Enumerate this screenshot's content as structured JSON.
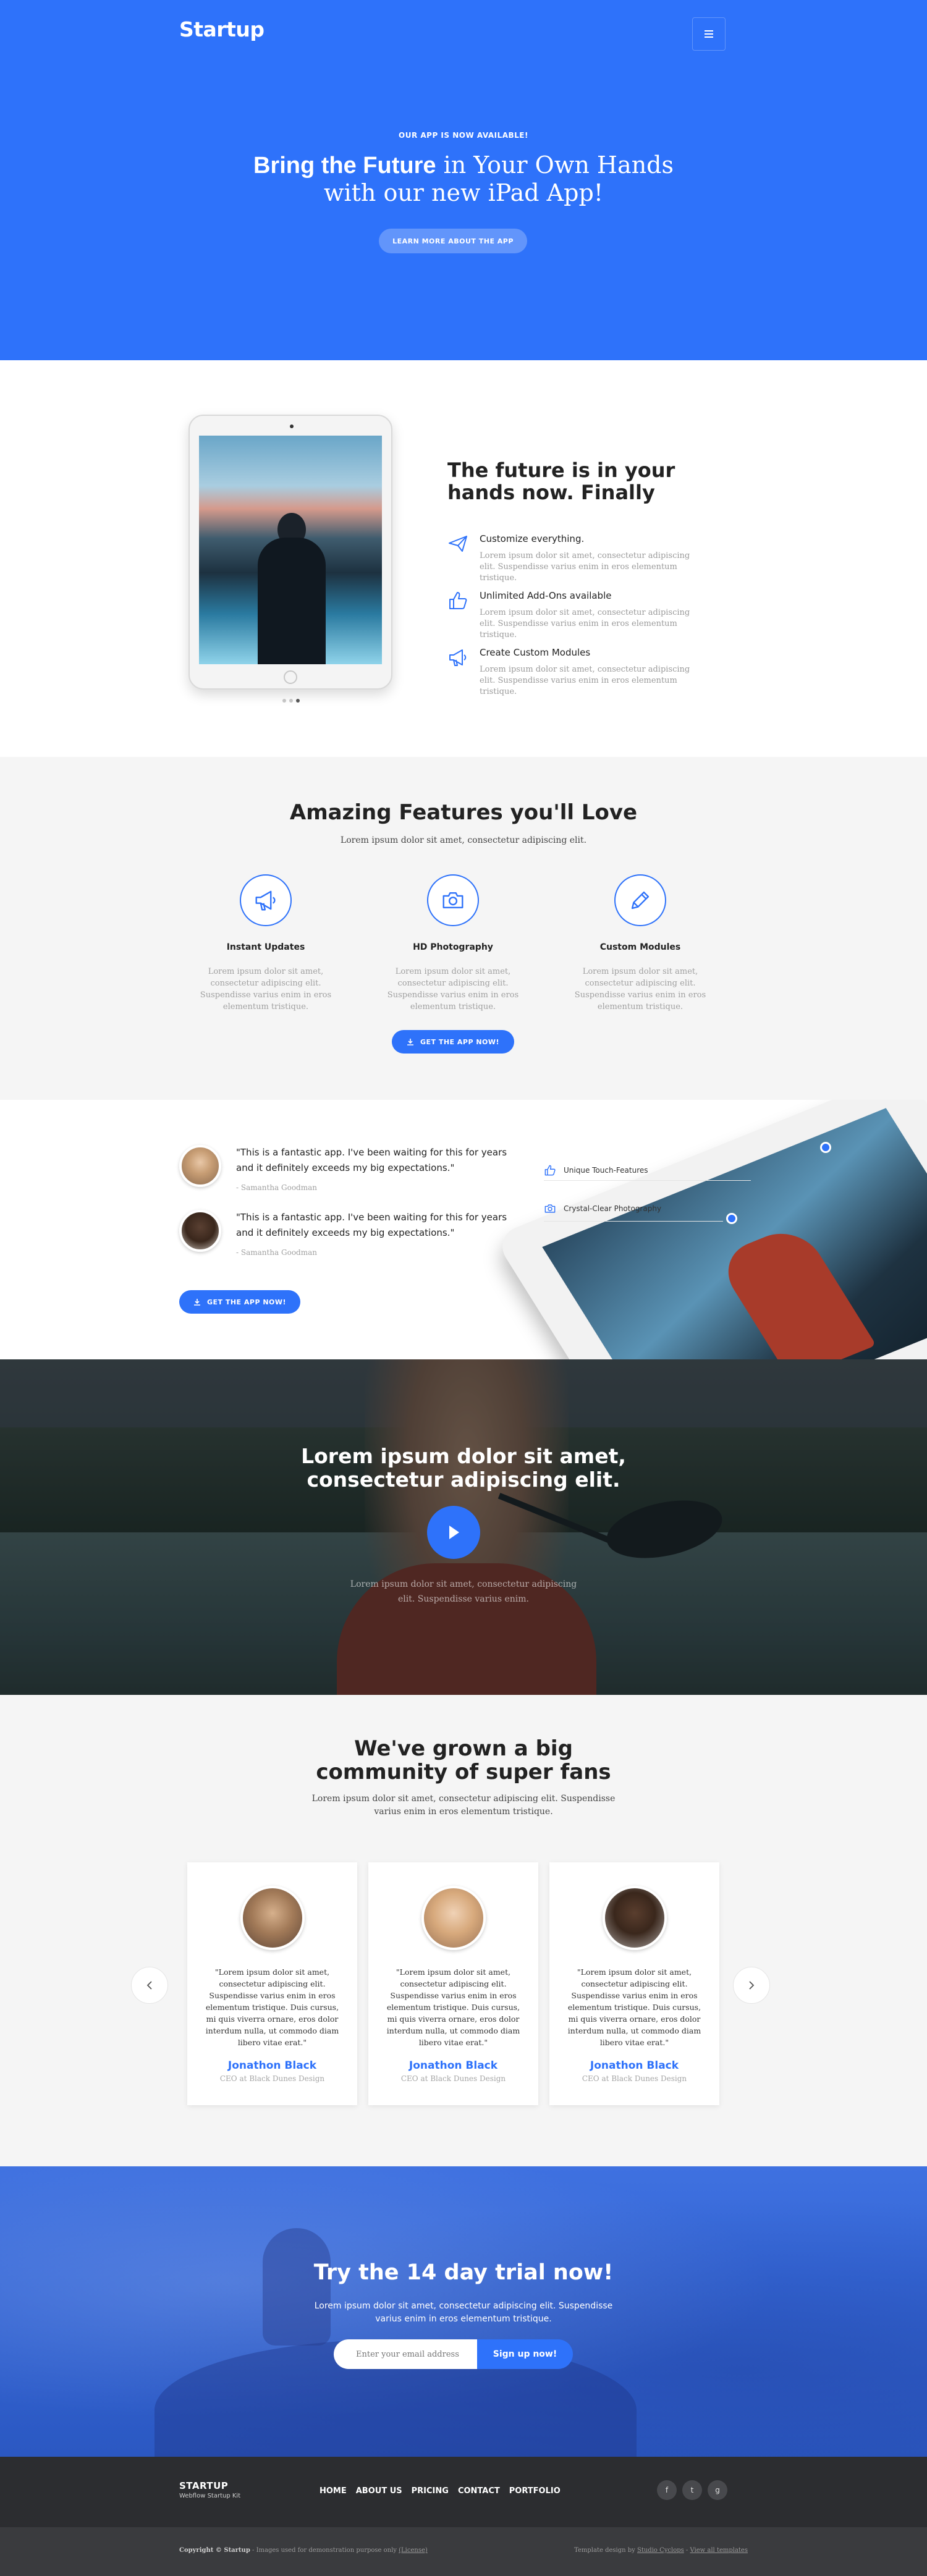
{
  "brand": {
    "logo": "Startup"
  },
  "hero": {
    "eyebrow": "OUR APP IS NOW AVAILABLE!",
    "title_bold": "Bring the Future",
    "title_light_1": " in Your Own Hands",
    "title_light_2": "with our new iPad App!",
    "button": "LEARN MORE ABOUT THE APP",
    "menu_icon": "hamburger-icon"
  },
  "intro": {
    "title": "The future is in your hands now. Finally",
    "features": [
      {
        "icon": "paper-plane-icon",
        "title": "Customize everything.",
        "desc": "Lorem ipsum dolor sit amet, consectetur adipiscing elit. Suspendisse varius enim in eros elementum tristique."
      },
      {
        "icon": "thumbs-up-icon",
        "title": "Unlimited Add-Ons available",
        "desc": "Lorem ipsum dolor sit amet, consectetur adipiscing elit. Suspendisse varius enim in eros elementum tristique."
      },
      {
        "icon": "megaphone-icon",
        "title": "Create Custom Modules",
        "desc": "Lorem ipsum dolor sit amet, consectetur adipiscing elit. Suspendisse varius enim in eros elementum tristique."
      }
    ]
  },
  "features": {
    "title": "Amazing Features you'll Love",
    "subtitle": "Lorem ipsum dolor sit amet, consectetur adipiscing elit.",
    "items": [
      {
        "icon": "megaphone-icon",
        "title": "Instant Updates",
        "desc": "Lorem ipsum dolor sit amet, consectetur adipiscing elit. Suspendisse varius enim in eros elementum tristique."
      },
      {
        "icon": "camera-icon",
        "title": "HD Photography",
        "desc": "Lorem ipsum dolor sit amet, consectetur adipiscing elit. Suspendisse varius enim in eros elementum tristique."
      },
      {
        "icon": "pencil-icon",
        "title": "Custom Modules",
        "desc": "Lorem ipsum dolor sit amet, consectetur adipiscing elit. Suspendisse varius enim in eros elementum tristique."
      }
    ],
    "button": "GET THE APP NOW!"
  },
  "testimonials": {
    "quotes": [
      {
        "text": "\"This is a fantastic app. I've been waiting for this for years and it definitely exceeds my big expectations.\"",
        "author": "- Samantha Goodman"
      },
      {
        "text": "\"This is a fantastic app. I've been waiting for this for years and it definitely exceeds my big expectations.\"",
        "author": "- Samantha Goodman"
      }
    ],
    "button": "GET THE APP NOW!",
    "hotspots": [
      {
        "icon": "thumbs-up-icon",
        "label": "Unique Touch-Features"
      },
      {
        "icon": "camera-icon",
        "label": "Crystal-Clear Photography"
      }
    ]
  },
  "video": {
    "title_1": "Lorem ipsum dolor sit amet,",
    "title_2": "consectetur adipiscing elit.",
    "desc_1": "Lorem ipsum dolor sit amet, consectetur adipiscing",
    "desc_2": "elit. Suspendisse varius enim."
  },
  "community": {
    "title_1": "We've grown a big",
    "title_2": "community of super fans",
    "subtitle_1": "Lorem ipsum dolor sit amet, consectetur adipiscing elit. Suspendisse",
    "subtitle_2": "varius enim in eros elementum tristique.",
    "cards": [
      {
        "quote": "\"Lorem ipsum dolor sit amet, consectetur adipiscing elit. Suspendisse varius enim in eros elementum tristique. Duis cursus, mi quis viverra ornare, eros dolor interdum nulla, ut commodo diam libero vitae erat.\"",
        "name": "Jonathon Black",
        "role": "CEO at Black Dunes Design"
      },
      {
        "quote": "\"Lorem ipsum dolor sit amet, consectetur adipiscing elit. Suspendisse varius enim in eros elementum tristique. Duis cursus, mi quis viverra ornare, eros dolor interdum nulla, ut commodo diam libero vitae erat.\"",
        "name": "Jonathon Black",
        "role": "CEO at Black Dunes Design"
      },
      {
        "quote": "\"Lorem ipsum dolor sit amet, consectetur adipiscing elit. Suspendisse varius enim in eros elementum tristique. Duis cursus, mi quis viverra ornare, eros dolor interdum nulla, ut commodo diam libero vitae erat.\"",
        "name": "Jonathon Black",
        "role": "CEO at Black Dunes Design"
      }
    ],
    "prev_icon": "chevron-left-icon",
    "next_icon": "chevron-right-icon"
  },
  "trial": {
    "title": "Try the 14 day trial now!",
    "subtitle_1": "Lorem ipsum dolor sit amet, consectetur adipiscing elit. Suspendisse",
    "subtitle_2": "varius enim in eros elementum tristique.",
    "email_placeholder": "Enter your email address",
    "button": "Sign up now!"
  },
  "footer": {
    "brand": "STARTUP",
    "tagline": "Webflow Startup Kit",
    "nav": [
      "HOME",
      "ABOUT US",
      "PRICING",
      "CONTACT",
      "PORTFOLIO"
    ],
    "social": [
      "f",
      "t",
      "g"
    ],
    "copyright_bold": "Copyright © Startup",
    "copyright_rest": " - Images used for demonstration purpose only ",
    "license": "(License)",
    "design_prefix": "Template design by ",
    "design_link": "Studio Cyclops",
    "design_sep": " - ",
    "templates_link": "View all templates"
  },
  "colors": {
    "accent": "#2e72fa",
    "footer": "#2c2d30",
    "subfooter": "#3a3b3e",
    "section_gray": "#f5f5f5"
  }
}
